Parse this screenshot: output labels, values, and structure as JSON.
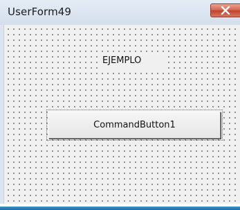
{
  "window": {
    "title": "UserForm49",
    "close_icon": "close-icon"
  },
  "form": {
    "label_text": "EJEMPLO",
    "button_label": "CommandButton1"
  },
  "colors": {
    "titlebar": "#dce4ef",
    "close_button": "#c9503a",
    "form_background": "#f0f0f0"
  }
}
